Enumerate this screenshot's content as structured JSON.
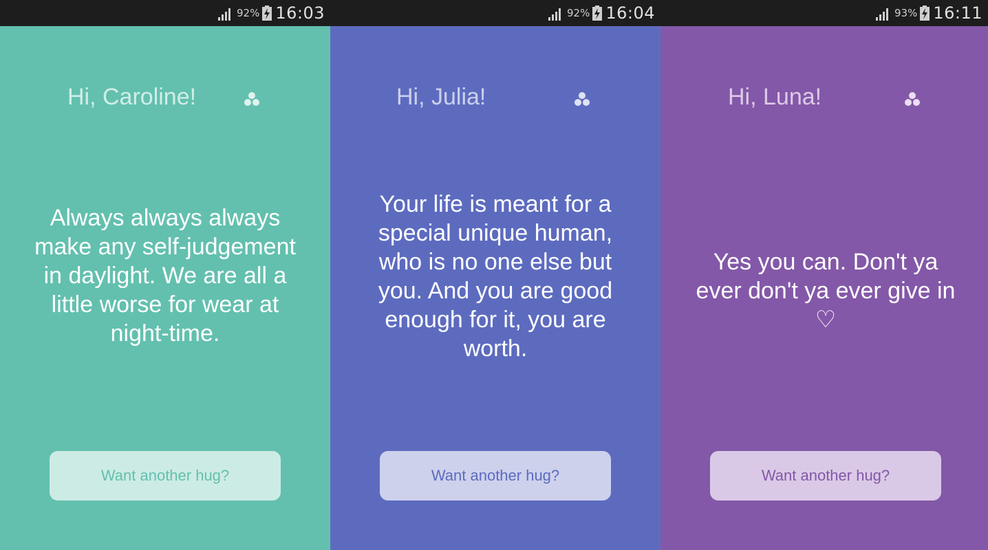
{
  "screens": [
    {
      "status": {
        "battery": "92%",
        "time": "16:03"
      },
      "greeting": "Hi, Caroline!",
      "quote": "Always always always make any self-judgement in daylight. We are all a little worse for wear at night-time.",
      "button_label": "Want another hug?",
      "colors": {
        "background": "#63c0ae",
        "greeting": "#e6f5f1",
        "icon": "#dff3ee",
        "button_bg": "#cdebe5",
        "button_text": "#63c0ae"
      }
    },
    {
      "status": {
        "battery": "92%",
        "time": "16:04"
      },
      "greeting": "Hi, Julia!",
      "quote": "Your life is meant for a special unique human, who is no one else but you. And you are good enough for it, you are worth.",
      "button_label": "Want another hug?",
      "colors": {
        "background": "#5d6bbf",
        "greeting": "#dfe2f4",
        "icon": "#dfe2f4",
        "button_bg": "#cdd1ec",
        "button_text": "#5d6bbf"
      }
    },
    {
      "status": {
        "battery": "93%",
        "time": "16:11"
      },
      "greeting": "Hi, Luna!",
      "quote": "Yes you can. Don't ya ever don't ya ever give in ♡",
      "button_label": "Want another hug?",
      "colors": {
        "background": "#8358a8",
        "greeting": "#ecdff4",
        "icon": "#ecdff4",
        "button_bg": "#dac9e6",
        "button_text": "#8358a8"
      }
    }
  ]
}
